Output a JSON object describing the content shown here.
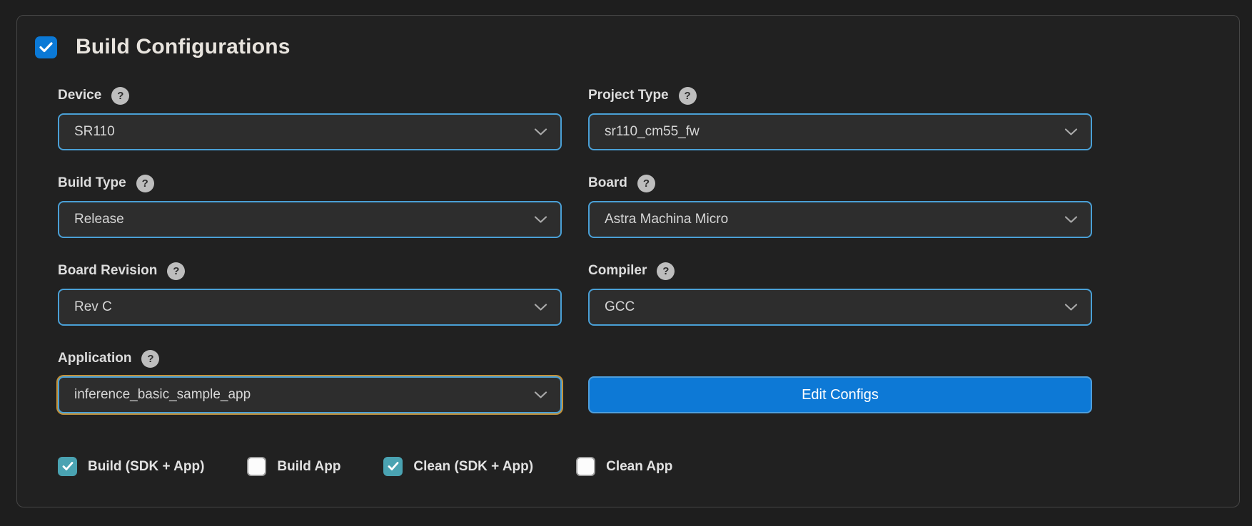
{
  "header": {
    "title": "Build Configurations",
    "checked": true
  },
  "form": {
    "fields": {
      "device": {
        "label": "Device",
        "value": "SR110"
      },
      "project_type": {
        "label": "Project Type",
        "value": "sr110_cm55_fw"
      },
      "build_type": {
        "label": "Build Type",
        "value": "Release"
      },
      "board": {
        "label": "Board",
        "value": "Astra Machina Micro"
      },
      "board_revision": {
        "label": "Board Revision",
        "value": "Rev C"
      },
      "compiler": {
        "label": "Compiler",
        "value": "GCC"
      },
      "application": {
        "label": "Application",
        "value": "inference_basic_sample_app"
      }
    },
    "edit_configs_label": "Edit Configs"
  },
  "checkboxes": [
    {
      "label": "Build (SDK + App)",
      "checked": true
    },
    {
      "label": "Build App",
      "checked": false
    },
    {
      "label": "Clean (SDK + App)",
      "checked": true
    },
    {
      "label": "Clean App",
      "checked": false
    }
  ],
  "icons": {
    "help": "?"
  },
  "colors": {
    "accent_blue": "#0d79d6",
    "select_border": "#4aa0d6",
    "checked_teal": "#4aa3b2",
    "application_focus_ring": "#c2913a",
    "panel_background": "#212121",
    "page_background": "#1e1e1e"
  }
}
